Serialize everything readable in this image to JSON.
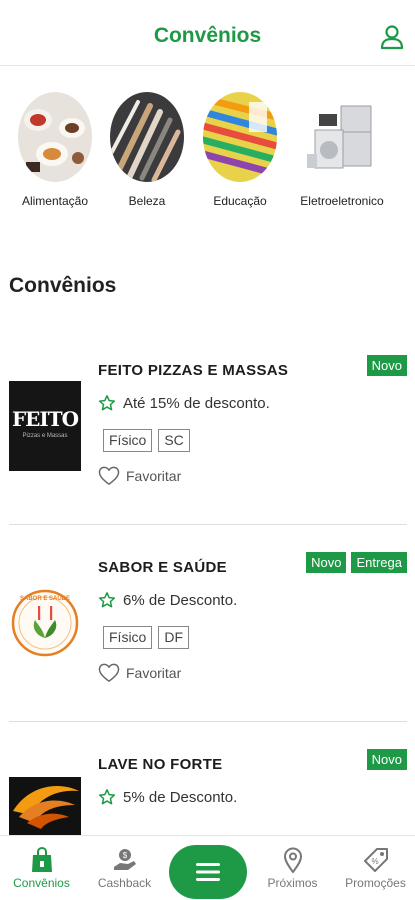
{
  "header": {
    "title": "Convênios",
    "accent": "#1e9a46"
  },
  "categories": [
    {
      "label": "Alimentação",
      "icon": "food-image"
    },
    {
      "label": "Beleza",
      "icon": "makeup-brushes-image"
    },
    {
      "label": "Educação",
      "icon": "school-supplies-image"
    },
    {
      "label": "Eletroeletronico",
      "icon": "appliances-image"
    }
  ],
  "section_title": "Convênios",
  "partners": [
    {
      "name": "FEITO PIZZAS E MASSAS",
      "badges": [
        "Novo"
      ],
      "discount": "Até 15% de desconto.",
      "tags": [
        "Físico",
        "SC"
      ],
      "favorite": "Favoritar",
      "logo_text": "FEITO",
      "logo_subtext": "Pizzas e Massas"
    },
    {
      "name": "SABOR E SAÚDE",
      "badges": [
        "Novo",
        "Entrega"
      ],
      "discount": "6% de Desconto.",
      "tags": [
        "Físico",
        "DF"
      ],
      "favorite": "Favoritar",
      "logo_text": "SABOR E SAÚDE"
    },
    {
      "name": "LAVE NO FORTE",
      "badges": [
        "Novo"
      ],
      "discount": "5% de Desconto."
    }
  ],
  "bottom_nav": {
    "items": [
      {
        "label": "Convênios",
        "icon": "shopping-bag-icon",
        "active": true
      },
      {
        "label": "Cashback",
        "icon": "cashback-hand-icon",
        "active": false
      },
      {
        "label": "",
        "icon": "menu-icon",
        "active": false
      },
      {
        "label": "Próximos",
        "icon": "location-pin-icon",
        "active": false
      },
      {
        "label": "Promoções",
        "icon": "price-tag-icon",
        "active": false
      }
    ]
  }
}
